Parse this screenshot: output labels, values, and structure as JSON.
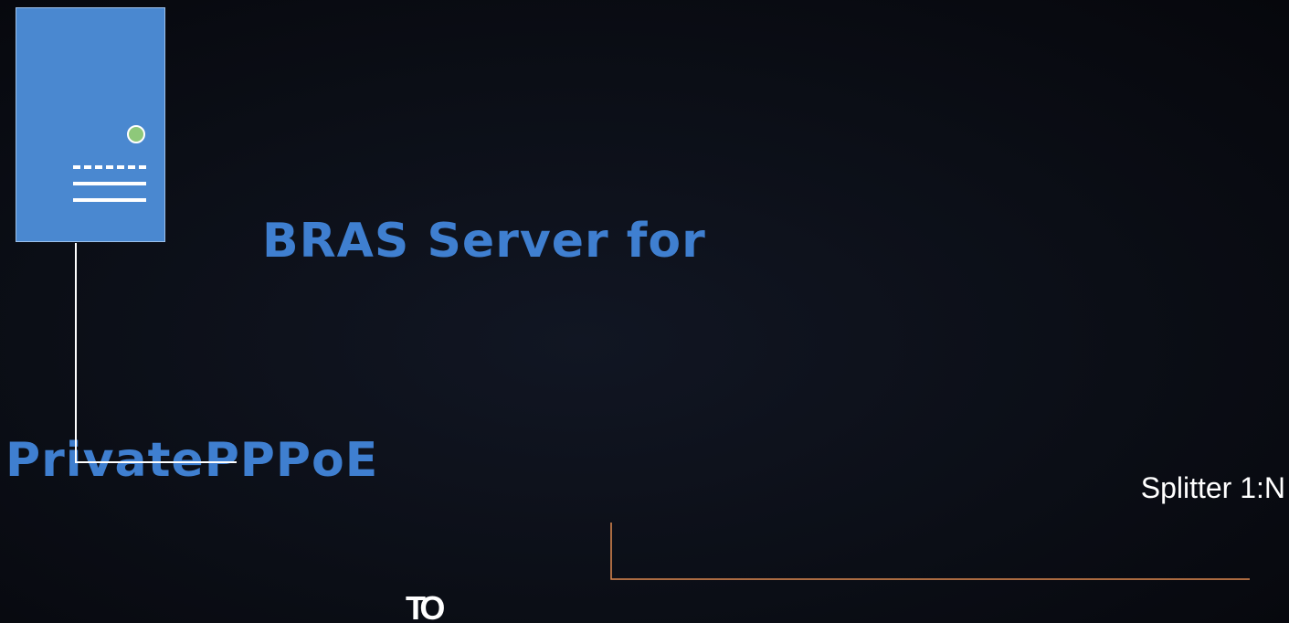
{
  "diagram": {
    "title_line1": "BRAS Server for",
    "title_line2": "PrivatePPPoE",
    "splitter_label": "Splitter 1:N",
    "logo_text": "TO"
  },
  "colors": {
    "background": "#0b0e16",
    "title": "#3f7fd0",
    "server_body": "#4a88d0",
    "server_led": "#8ec87a",
    "uplink_line": "#ffffff",
    "fiber_line": "#e08a50",
    "label_text": "#ffffff"
  },
  "icons": {
    "server": "server-icon",
    "status_light": "status-led-icon"
  }
}
